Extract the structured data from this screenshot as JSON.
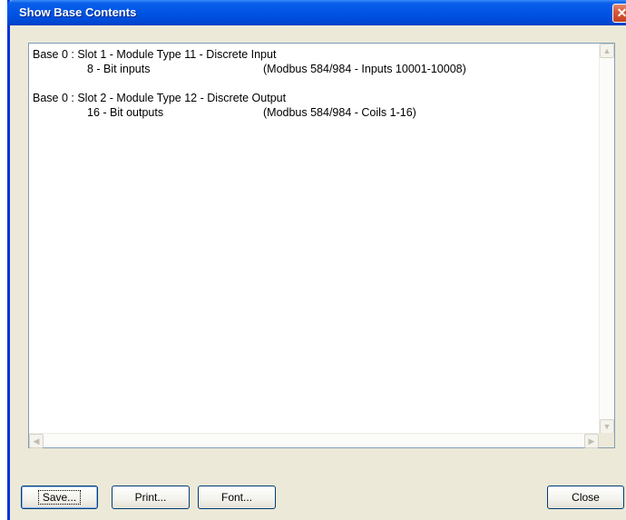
{
  "window": {
    "title": "Show Base Contents",
    "close_glyph": "✕"
  },
  "contents": [
    {
      "header": "Base 0 : Slot 1 - Module Type 11 - Discrete Input",
      "count": "8 - Bit inputs",
      "modbus": "(Modbus 584/984 - Inputs 10001-10008)"
    },
    {
      "header": "Base 0 : Slot 2 - Module Type 12 - Discrete Output",
      "count": "16 - Bit outputs",
      "modbus": "(Modbus 584/984 - Coils 1-16)"
    }
  ],
  "scroll": {
    "up_glyph": "▲",
    "down_glyph": "▼",
    "left_glyph": "◀",
    "right_glyph": "▶"
  },
  "buttons": {
    "save": "Save...",
    "print": "Print...",
    "font": "Font...",
    "close": "Close"
  },
  "colors": {
    "titlebar": "#0055e5",
    "window_bg": "#ece9d8",
    "button_border": "#003c74"
  }
}
